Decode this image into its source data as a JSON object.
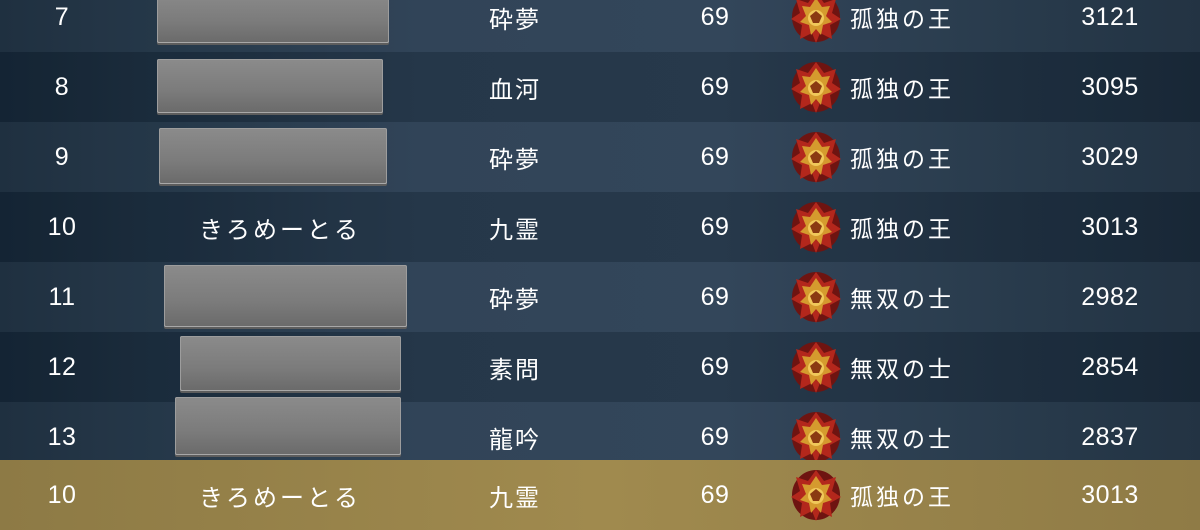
{
  "leaderboard": {
    "rows": [
      {
        "rank": "7",
        "name": "",
        "name_hidden": true,
        "guild": "砕夢",
        "level": "69",
        "title_icon": "dragon-crest-icon",
        "title": "孤独の王",
        "score": "3121"
      },
      {
        "rank": "8",
        "name": "",
        "name_hidden": true,
        "guild": "血河",
        "level": "69",
        "title_icon": "dragon-crest-icon",
        "title": "孤独の王",
        "score": "3095"
      },
      {
        "rank": "9",
        "name": "",
        "name_hidden": true,
        "guild": "砕夢",
        "level": "69",
        "title_icon": "dragon-crest-icon",
        "title": "孤独の王",
        "score": "3029"
      },
      {
        "rank": "10",
        "name": "きろめーとる",
        "name_hidden": false,
        "guild": "九霊",
        "level": "69",
        "title_icon": "dragon-crest-icon",
        "title": "孤独の王",
        "score": "3013"
      },
      {
        "rank": "11",
        "name": "",
        "name_hidden": true,
        "guild": "砕夢",
        "level": "69",
        "title_icon": "dragon-crest-icon",
        "title": "無双の士",
        "score": "2982"
      },
      {
        "rank": "12",
        "name": "",
        "name_hidden": true,
        "guild": "素問",
        "level": "69",
        "title_icon": "dragon-crest-icon",
        "title": "無双の士",
        "score": "2854"
      },
      {
        "rank": "13",
        "name": "",
        "name_hidden": true,
        "guild": "龍吟",
        "level": "69",
        "title_icon": "dragon-crest-icon",
        "title": "無双の士",
        "score": "2837"
      }
    ],
    "self_row": {
      "rank": "10",
      "name": "きろめーとる",
      "guild": "九霊",
      "level": "69",
      "title_icon": "dragon-crest-icon",
      "title": "孤独の王",
      "score": "3013"
    }
  },
  "colors": {
    "background": "#263a4e",
    "self_highlight": "#9c874c",
    "redaction": "#7d7d7d",
    "text": "#ffffff"
  }
}
